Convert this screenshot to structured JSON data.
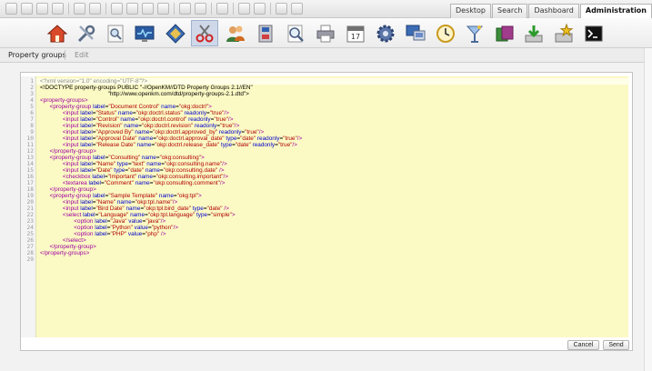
{
  "top_tabs": [
    "Desktop",
    "Search",
    "Dashboard",
    "Administration"
  ],
  "active_tab": "Administration",
  "admin_icons": [
    "home-icon",
    "tools-icon",
    "document-search-icon",
    "monitor-icon",
    "diamond-icon",
    "scissors-icon",
    "users-icon",
    "cabinet-icon",
    "magnifier-icon",
    "printer-icon",
    "calendar-icon",
    "gear-icon",
    "computer-icon",
    "clock-icon",
    "cocktail-icon",
    "folders-icon",
    "import-icon",
    "export-star-icon",
    "terminal-icon"
  ],
  "breadcrumb": {
    "item1": "Property groups",
    "item2": "Edit"
  },
  "buttons": {
    "cancel": "Cancel",
    "send": "Send"
  },
  "line_numbers": [
    "1",
    "2",
    "3",
    "4",
    "5",
    "6",
    "7",
    "8",
    "9",
    "10",
    "11",
    "12",
    "13",
    "14",
    "15",
    "16",
    "17",
    "18",
    "19",
    "20",
    "21",
    "22",
    "23",
    "24",
    "25",
    "26",
    "27",
    "28",
    "29"
  ],
  "code": [
    [
      [
        "cm",
        "<?xml version=\"1.0\" encoding=\"UTF-8\"?>"
      ]
    ],
    [
      [
        "d",
        "<!DOCTYPE property-groups PUBLIC \"-//OpenKM//DTD Property Groups 2.1//EN\""
      ]
    ],
    [
      [
        "d",
        "                                          \"http://www.openkm.com/dtd/property-groups-2.1.dtd\">"
      ]
    ],
    [
      [
        "t",
        "<property-groups>"
      ]
    ],
    [
      [
        "t",
        "      <property-group "
      ],
      [
        "a",
        "label"
      ],
      [
        "d",
        "="
      ],
      [
        "v",
        "\"Document Control\""
      ],
      [
        "a",
        " name"
      ],
      [
        "d",
        "="
      ],
      [
        "v",
        "\"okg:doctrl\""
      ],
      [
        "t",
        ">"
      ]
    ],
    [
      [
        "t",
        "              <input "
      ],
      [
        "a",
        "label"
      ],
      [
        "d",
        "="
      ],
      [
        "v",
        "\"Status\""
      ],
      [
        "a",
        " name"
      ],
      [
        "d",
        "="
      ],
      [
        "v",
        "\"okp:doctrl.status\""
      ],
      [
        "a",
        " readonly"
      ],
      [
        "d",
        "="
      ],
      [
        "v",
        "\"true\""
      ],
      [
        "t",
        "/>"
      ]
    ],
    [
      [
        "t",
        "              <input "
      ],
      [
        "a",
        "label"
      ],
      [
        "d",
        "="
      ],
      [
        "v",
        "\"Control\""
      ],
      [
        "a",
        " name"
      ],
      [
        "d",
        "="
      ],
      [
        "v",
        "\"okp:doctrl.control\""
      ],
      [
        "a",
        " readonly"
      ],
      [
        "d",
        "="
      ],
      [
        "v",
        "\"true\""
      ],
      [
        "t",
        "/>"
      ]
    ],
    [
      [
        "t",
        "              <input "
      ],
      [
        "a",
        "label"
      ],
      [
        "d",
        "="
      ],
      [
        "v",
        "\"Revision\""
      ],
      [
        "a",
        " name"
      ],
      [
        "d",
        "="
      ],
      [
        "v",
        "\"okp:doctrl.revision\""
      ],
      [
        "a",
        " readonly"
      ],
      [
        "d",
        "="
      ],
      [
        "v",
        "\"true\""
      ],
      [
        "t",
        "/>"
      ]
    ],
    [
      [
        "t",
        "              <input "
      ],
      [
        "a",
        "label"
      ],
      [
        "d",
        "="
      ],
      [
        "v",
        "\"Approved By\""
      ],
      [
        "a",
        " name"
      ],
      [
        "d",
        "="
      ],
      [
        "v",
        "\"okp:doctrl.approved_by\""
      ],
      [
        "a",
        " readonly"
      ],
      [
        "d",
        "="
      ],
      [
        "v",
        "\"true\""
      ],
      [
        "t",
        "/>"
      ]
    ],
    [
      [
        "t",
        "              <input "
      ],
      [
        "a",
        "label"
      ],
      [
        "d",
        "="
      ],
      [
        "v",
        "\"Approval Date\""
      ],
      [
        "a",
        " name"
      ],
      [
        "d",
        "="
      ],
      [
        "v",
        "\"okp:doctrl.approval_date\""
      ],
      [
        "a",
        " type"
      ],
      [
        "d",
        "="
      ],
      [
        "v",
        "\"date\""
      ],
      [
        "a",
        " readonly"
      ],
      [
        "d",
        "="
      ],
      [
        "v",
        "\"true\""
      ],
      [
        "t",
        "/>"
      ]
    ],
    [
      [
        "t",
        "              <input "
      ],
      [
        "a",
        "label"
      ],
      [
        "d",
        "="
      ],
      [
        "v",
        "\"Release Date\""
      ],
      [
        "a",
        " name"
      ],
      [
        "d",
        "="
      ],
      [
        "v",
        "\"okp:doctrl.release_date\""
      ],
      [
        "a",
        " type"
      ],
      [
        "d",
        "="
      ],
      [
        "v",
        "\"date\""
      ],
      [
        "a",
        " readonly"
      ],
      [
        "d",
        "="
      ],
      [
        "v",
        "\"true\""
      ],
      [
        "t",
        "/>"
      ]
    ],
    [
      [
        "t",
        "      </property-group>"
      ]
    ],
    [
      [
        "t",
        "      <property-group "
      ],
      [
        "a",
        "label"
      ],
      [
        "d",
        "="
      ],
      [
        "v",
        "\"Consulting\""
      ],
      [
        "a",
        " name"
      ],
      [
        "d",
        "="
      ],
      [
        "v",
        "\"okg:consulting\""
      ],
      [
        "t",
        ">"
      ]
    ],
    [
      [
        "t",
        "              <input "
      ],
      [
        "a",
        "label"
      ],
      [
        "d",
        "="
      ],
      [
        "v",
        "\"Name\""
      ],
      [
        "a",
        " type"
      ],
      [
        "d",
        "="
      ],
      [
        "v",
        "\"text\""
      ],
      [
        "a",
        " name"
      ],
      [
        "d",
        "="
      ],
      [
        "v",
        "\"okp:consulting.name\""
      ],
      [
        "t",
        "/>"
      ]
    ],
    [
      [
        "t",
        "              <input "
      ],
      [
        "a",
        "label"
      ],
      [
        "d",
        "="
      ],
      [
        "v",
        "\"Date\""
      ],
      [
        "a",
        " type"
      ],
      [
        "d",
        "="
      ],
      [
        "v",
        "\"date\""
      ],
      [
        "a",
        " name"
      ],
      [
        "d",
        "="
      ],
      [
        "v",
        "\"okp:consulting.date\""
      ],
      [
        "t",
        " />"
      ]
    ],
    [
      [
        "t",
        "              <checkbox "
      ],
      [
        "a",
        "label"
      ],
      [
        "d",
        "="
      ],
      [
        "v",
        "\"Important\""
      ],
      [
        "a",
        " name"
      ],
      [
        "d",
        "="
      ],
      [
        "v",
        "\"okp:consulting.important\""
      ],
      [
        "t",
        "/>"
      ]
    ],
    [
      [
        "t",
        "              <textarea "
      ],
      [
        "a",
        "label"
      ],
      [
        "d",
        "="
      ],
      [
        "v",
        "\"Comment\""
      ],
      [
        "a",
        " name"
      ],
      [
        "d",
        "="
      ],
      [
        "v",
        "\"okp:consulting.comment\""
      ],
      [
        "t",
        "/>"
      ]
    ],
    [
      [
        "t",
        "      </property-group>"
      ]
    ],
    [
      [
        "t",
        "      <property-group "
      ],
      [
        "a",
        "label"
      ],
      [
        "d",
        "="
      ],
      [
        "v",
        "\"Sample Template\""
      ],
      [
        "a",
        " name"
      ],
      [
        "d",
        "="
      ],
      [
        "v",
        "\"okg:tpl\""
      ],
      [
        "t",
        ">"
      ]
    ],
    [
      [
        "t",
        "              <input "
      ],
      [
        "a",
        "label"
      ],
      [
        "d",
        "="
      ],
      [
        "v",
        "\"Name\""
      ],
      [
        "a",
        " name"
      ],
      [
        "d",
        "="
      ],
      [
        "v",
        "\"okp:tpl.name\""
      ],
      [
        "t",
        "/>"
      ]
    ],
    [
      [
        "t",
        "              <input "
      ],
      [
        "a",
        "label"
      ],
      [
        "d",
        "="
      ],
      [
        "v",
        "\"Bird Date\""
      ],
      [
        "a",
        " name"
      ],
      [
        "d",
        "="
      ],
      [
        "v",
        "\"okp:tpl.bird_date\""
      ],
      [
        "a",
        " type"
      ],
      [
        "d",
        "="
      ],
      [
        "v",
        "\"date\""
      ],
      [
        "t",
        " />"
      ]
    ],
    [
      [
        "t",
        "              <select "
      ],
      [
        "a",
        "label"
      ],
      [
        "d",
        "="
      ],
      [
        "v",
        "\"Language\""
      ],
      [
        "a",
        " name"
      ],
      [
        "d",
        "="
      ],
      [
        "v",
        "\"okp:tpl.language\""
      ],
      [
        "a",
        " type"
      ],
      [
        "d",
        "="
      ],
      [
        "v",
        "\"simple\""
      ],
      [
        "t",
        ">"
      ]
    ],
    [
      [
        "t",
        "                     <option "
      ],
      [
        "a",
        "label"
      ],
      [
        "d",
        "="
      ],
      [
        "v",
        "\"Java\""
      ],
      [
        "a",
        " value"
      ],
      [
        "d",
        "="
      ],
      [
        "v",
        "\"java\""
      ],
      [
        "t",
        "/>"
      ]
    ],
    [
      [
        "t",
        "                     <option "
      ],
      [
        "a",
        "label"
      ],
      [
        "d",
        "="
      ],
      [
        "v",
        "\"Python\""
      ],
      [
        "a",
        " value"
      ],
      [
        "d",
        "="
      ],
      [
        "v",
        "\"python\""
      ],
      [
        "t",
        "/>"
      ]
    ],
    [
      [
        "t",
        "                     <option "
      ],
      [
        "a",
        "label"
      ],
      [
        "d",
        "="
      ],
      [
        "v",
        "\"PHP\""
      ],
      [
        "a",
        " value"
      ],
      [
        "d",
        "="
      ],
      [
        "v",
        "\"php\""
      ],
      [
        "t",
        " />"
      ]
    ],
    [
      [
        "t",
        "              </select>"
      ]
    ],
    [
      [
        "t",
        "      </property-group>"
      ]
    ],
    [
      [
        "t",
        "</property-groups>"
      ]
    ],
    [
      [
        "d",
        ""
      ]
    ]
  ]
}
